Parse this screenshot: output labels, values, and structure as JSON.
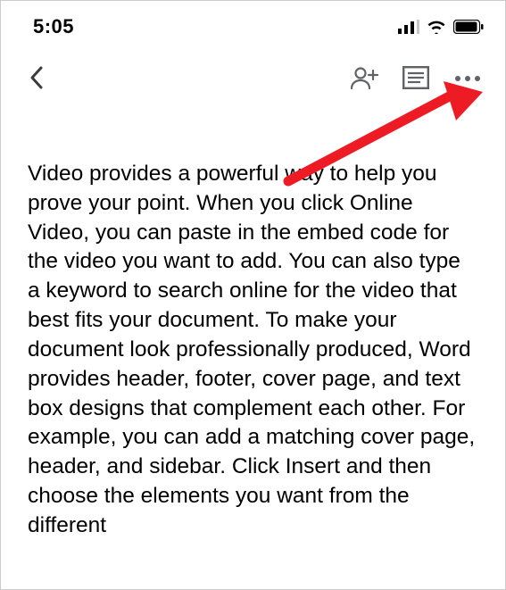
{
  "status": {
    "time": "5:05"
  },
  "nav": {
    "icons": {
      "back": "chevron-left",
      "add_person": "person-add",
      "view_mode": "document-text",
      "more": "more-horizontal"
    }
  },
  "document": {
    "body": "Video provides a powerful way to help you prove your point. When you click Online Video, you can paste in the embed code for the video you want to add. You can also type a keyword to search online for the video that best fits your document. To make your document look professionally produced, Word provides header, footer, cover page, and text box designs that complement each other. For example, you can add a matching cover page, header, and sidebar. Click Insert and then choose the elements you want from the different"
  },
  "annotation": {
    "color": "#ed1c24",
    "target": "more-options-button"
  }
}
